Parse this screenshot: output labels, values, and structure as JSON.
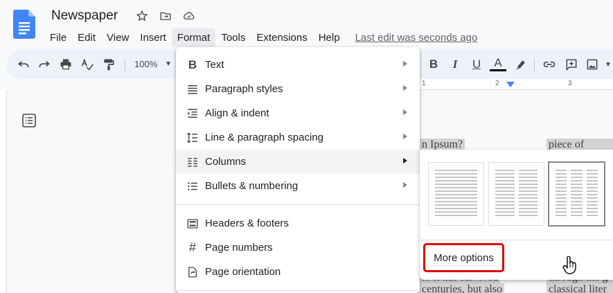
{
  "title": "Newspaper",
  "menu": [
    "File",
    "Edit",
    "View",
    "Insert",
    "Format",
    "Tools",
    "Extensions",
    "Help"
  ],
  "active_menu": "Format",
  "last_edit": "Last edit was seconds ago",
  "toolbar": {
    "zoom": "100%",
    "bold": "B",
    "italic": "I",
    "underline": "U",
    "text_color": "A"
  },
  "ruler": [
    "1",
    "2",
    "3"
  ],
  "doc_snippets": [
    "n Ipsum?",
    "piece   of",
    "k. It has survived",
    "centuries, but also",
    "through the g",
    "classical  liter"
  ],
  "format_menu": {
    "items": [
      {
        "label": "Text",
        "icon": "bold-icon",
        "submenu": true
      },
      {
        "label": "Paragraph styles",
        "icon": "paragraph-styles-icon",
        "submenu": true
      },
      {
        "label": "Align & indent",
        "icon": "align-indent-icon",
        "submenu": true
      },
      {
        "label": "Line & paragraph spacing",
        "icon": "line-spacing-icon",
        "submenu": true
      },
      {
        "label": "Columns",
        "icon": "columns-icon",
        "submenu": true,
        "highlighted": true
      },
      {
        "label": "Bullets & numbering",
        "icon": "bullets-icon",
        "submenu": true
      }
    ],
    "items2": [
      {
        "label": "Headers & footers",
        "icon": "headers-footers-icon"
      },
      {
        "label": "Page numbers",
        "icon": "hash-icon"
      },
      {
        "label": "Page orientation",
        "icon": "page-orientation-icon"
      }
    ]
  },
  "columns_submenu": {
    "presets": [
      {
        "name": "one-column",
        "columns": 1
      },
      {
        "name": "two-columns",
        "columns": 2
      },
      {
        "name": "three-columns",
        "columns": 3,
        "selected": true
      }
    ],
    "more_options": "More options"
  },
  "colors": {
    "accent_red": "#e00000",
    "docs_blue": "#4285f4",
    "toolbar_bg": "#edf2fa",
    "hover": "#f1f3f4"
  }
}
